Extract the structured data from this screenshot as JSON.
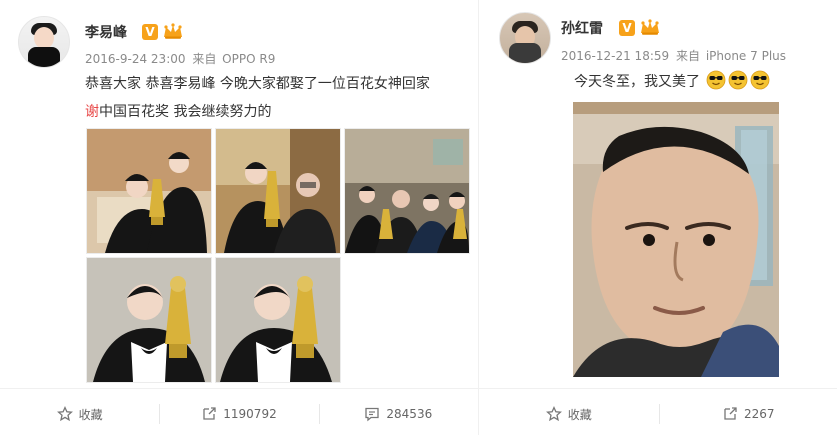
{
  "left_post": {
    "username": "李易峰",
    "verified_badge": "V",
    "timestamp": "2016-9-24 23:00",
    "from_label": "来自",
    "device": "OPPO R9",
    "text_line1": "恭喜大家 恭喜李易峰 今晚大家都娶了一位百花女神回家",
    "text_line2_mark": "谢",
    "text_line2_rest": "中国百花奖 我会继续努力的",
    "photos_count": 5,
    "actions": {
      "favorite_label": "收藏",
      "repost_count": "1190792",
      "comment_count": "284536"
    },
    "icons": {
      "favorite": "star-icon",
      "repost": "share-icon",
      "comment": "comment-icon",
      "vip": "crown-icon"
    }
  },
  "right_post": {
    "username": "孙红雷",
    "verified_badge": "V",
    "timestamp": "2016-12-21 18:59",
    "from_label": "来自",
    "device": "iPhone 7 Plus",
    "text": "今天冬至，我又美了",
    "emoji_count": 3,
    "actions": {
      "favorite_label": "收藏",
      "repost_count": "2267"
    },
    "icons": {
      "favorite": "star-icon",
      "repost": "share-icon",
      "emoji": "sunglasses-smile-icon",
      "vip": "crown-icon"
    }
  },
  "colors": {
    "accent_red": "#e84848",
    "badge_orange": "#f7a21a",
    "meta_gray": "#8a8a8a",
    "text": "#333333"
  }
}
